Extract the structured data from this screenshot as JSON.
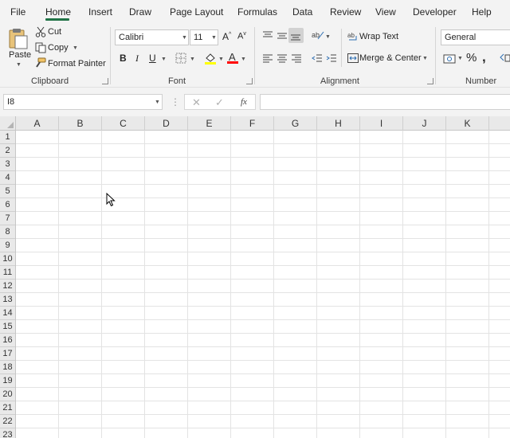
{
  "tabs": [
    "File",
    "Home",
    "Insert",
    "Draw",
    "Page Layout",
    "Formulas",
    "Data",
    "Review",
    "View",
    "Developer",
    "Help"
  ],
  "active_tab": "Home",
  "accent_color": "#217346",
  "ribbon": {
    "clipboard": {
      "paste_label": "Paste",
      "cut_label": "Cut",
      "copy_label": "Copy",
      "format_painter_label": "Format Painter",
      "group_label": "Clipboard"
    },
    "font": {
      "font_name": "Calibri",
      "font_size": "11",
      "bold": "B",
      "italic": "I",
      "underline": "U",
      "fill_color": "#ffff00",
      "font_color": "#ff0000",
      "group_label": "Font"
    },
    "alignment": {
      "wrap_text_label": "Wrap Text",
      "merge_center_label": "Merge & Center",
      "group_label": "Alignment"
    },
    "number": {
      "format": "General",
      "group_label": "Number"
    }
  },
  "formula_bar": {
    "name_box": "I8",
    "fx": "fx",
    "content": ""
  },
  "grid": {
    "columns": [
      "A",
      "B",
      "C",
      "D",
      "E",
      "F",
      "G",
      "H",
      "I",
      "J",
      "K"
    ],
    "rows": [
      "1",
      "2",
      "3",
      "4",
      "5",
      "6",
      "7",
      "8",
      "9",
      "10",
      "11",
      "12",
      "13",
      "14",
      "15",
      "16",
      "17",
      "18",
      "19",
      "20",
      "21",
      "22",
      "23"
    ]
  }
}
